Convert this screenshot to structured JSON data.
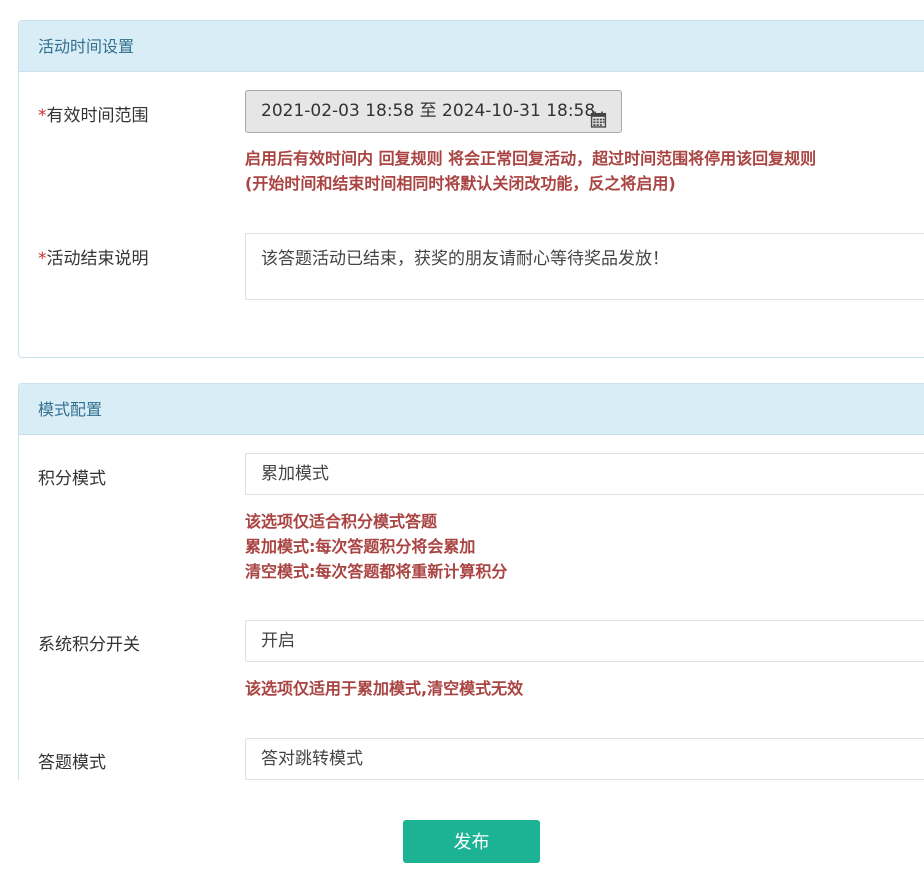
{
  "time_panel": {
    "heading": "活动时间设置",
    "valid_range": {
      "required_mark": "*",
      "label": "有效时间范围",
      "value": "2021-02-03 18:58 至 2024-10-31 18:58",
      "help_lines": [
        "启用后有效时间内 回复规则 将会正常回复活动，超过时间范围将停用该回复规则",
        "(开始时间和结束时间相同时将默认关闭改功能，反之将启用)"
      ]
    },
    "end_note": {
      "required_mark": "*",
      "label": "活动结束说明",
      "value": "该答题活动已结束，获奖的朋友请耐心等待奖品发放！"
    }
  },
  "mode_panel": {
    "heading": "模式配置",
    "score_mode": {
      "label": "积分模式",
      "value": "累加模式",
      "help_lines": [
        "该选项仅适合积分模式答题",
        "累加模式:每次答题积分将会累加",
        "清空模式:每次答题都将重新计算积分"
      ]
    },
    "system_score": {
      "label": "系统积分开关",
      "value": "开启",
      "help_lines": [
        "该选项仅适用于累加模式,清空模式无效"
      ]
    },
    "answer_mode": {
      "label": "答题模式",
      "value": "答对跳转模式"
    }
  },
  "footer": {
    "publish_label": "发布",
    "publish_color": "#1bb394"
  },
  "icons": {
    "calendar": "calendar-icon"
  },
  "colors": {
    "panel_heading_bg": "#d9edf7",
    "panel_heading_text": "#31708f",
    "help_text": "#a94442",
    "required_mark": "#c9302c"
  }
}
